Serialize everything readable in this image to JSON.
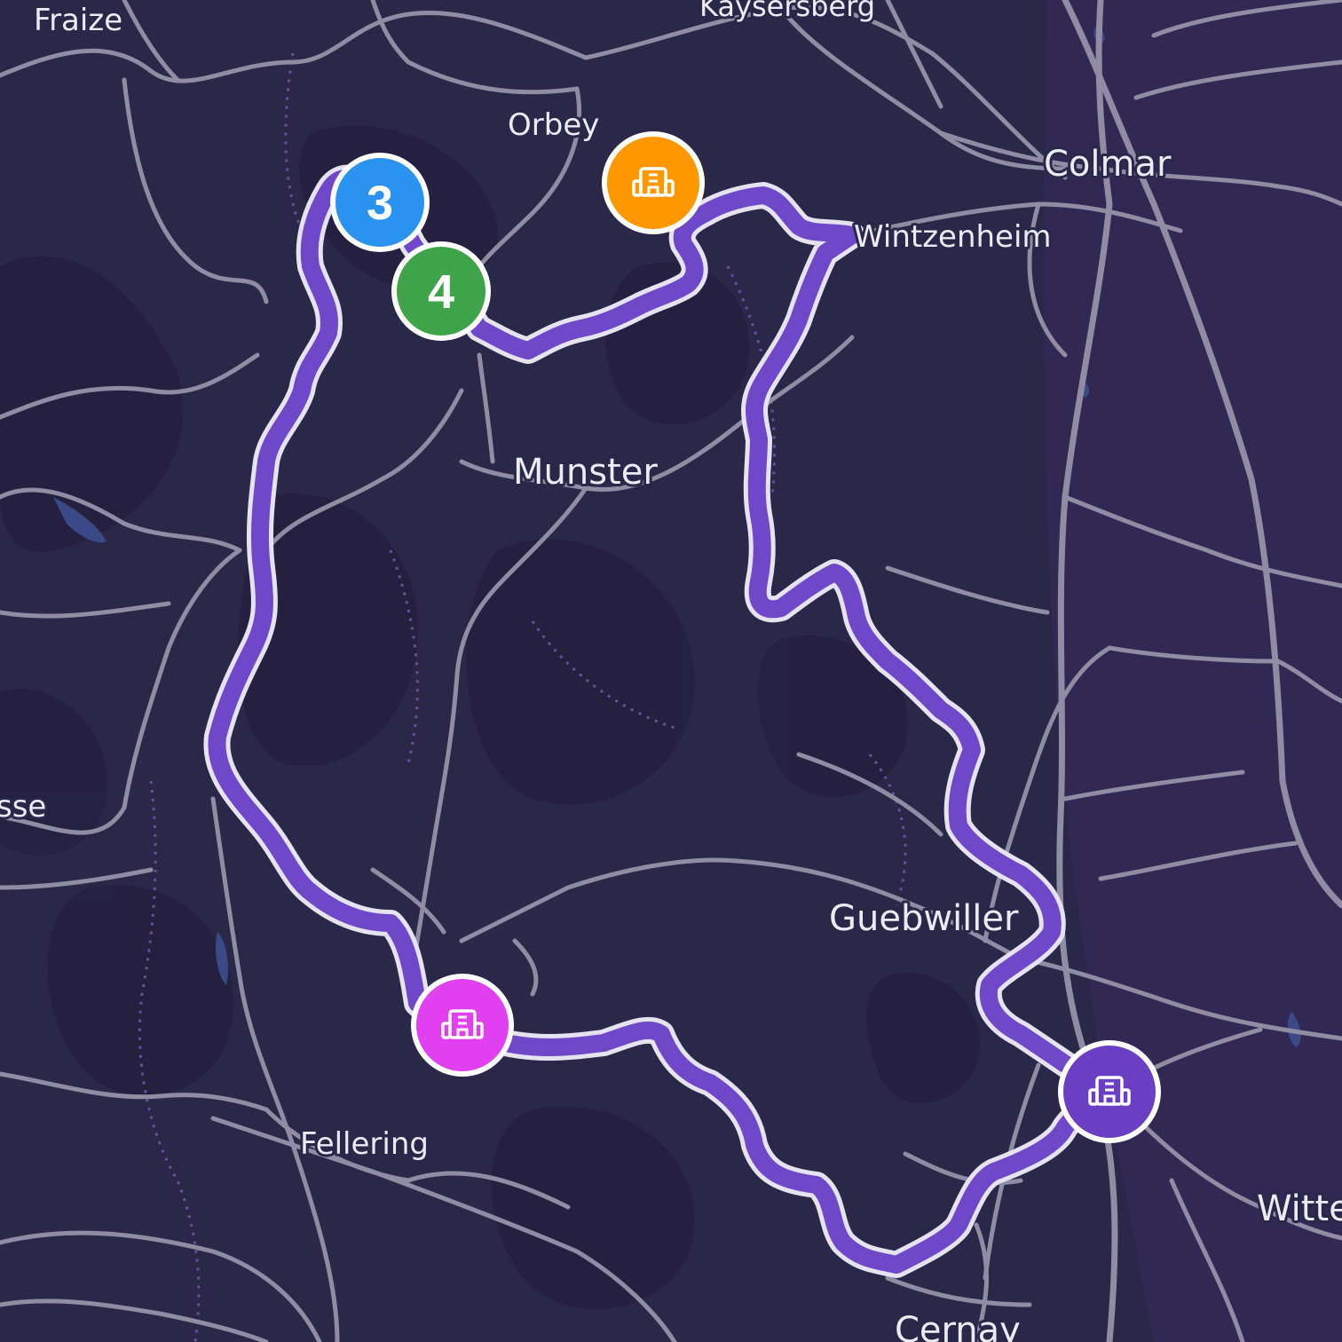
{
  "places": {
    "fraize": "Fraize",
    "kaysersberg": "Kaysersberg",
    "orbey": "Orbey",
    "colmar": "Colmar",
    "wintzenheim": "Wintzenheim",
    "munster": "Munster",
    "guebwiller": "Guebwiller",
    "fellering": "Fellering",
    "cernay": "Cernay",
    "witte": "Witte",
    "sse": "sse"
  },
  "markers": {
    "stop_3": {
      "label": "3",
      "color": "#2a93f0",
      "icon": "number-badge"
    },
    "stop_4": {
      "label": "4",
      "color": "#3fa34a",
      "icon": "number-badge"
    },
    "hotel_orange": {
      "color": "#ff9800",
      "icon": "hotel-building-icon"
    },
    "hotel_magenta": {
      "color": "#e040f0",
      "icon": "hotel-building-icon"
    },
    "hotel_purple": {
      "color": "#6a3fc4",
      "icon": "hotel-building-icon"
    }
  },
  "colors": {
    "background": "#2b2748",
    "road": "#8f8ca3",
    "route": "#6f48c9",
    "route_outline": "#e6e3f0"
  }
}
